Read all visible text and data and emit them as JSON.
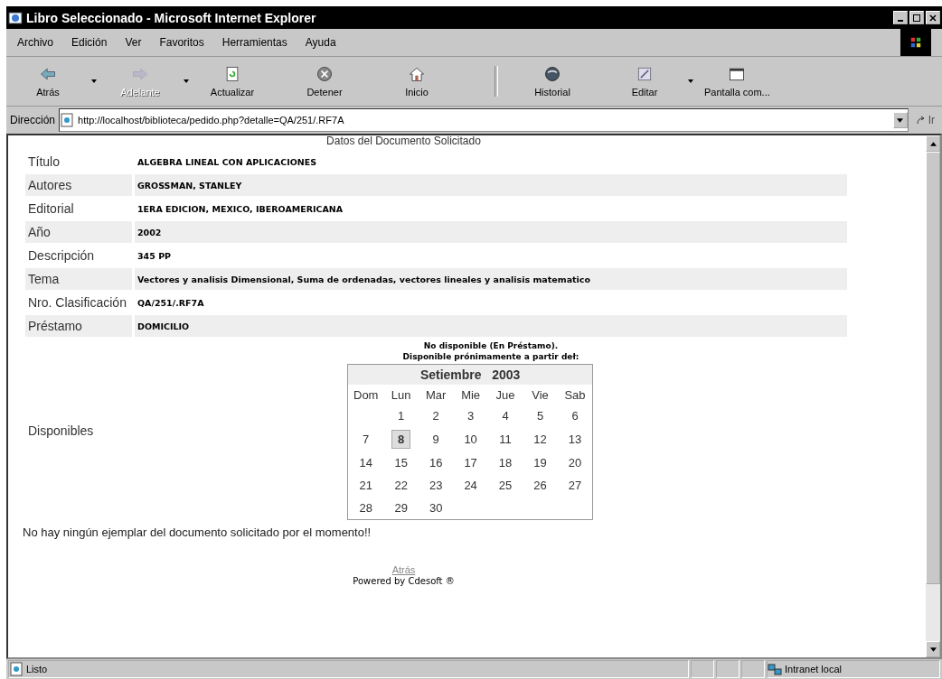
{
  "window": {
    "title": "Libro Seleccionado - Microsoft Internet Explorer"
  },
  "menu": [
    "Archivo",
    "Edición",
    "Ver",
    "Favoritos",
    "Herramientas",
    "Ayuda"
  ],
  "toolbar": [
    {
      "label": "Atrás",
      "kind": "back",
      "disabled": false,
      "dropdown": true
    },
    {
      "label": "Adelante",
      "kind": "forward",
      "disabled": true,
      "dropdown": true
    },
    {
      "label": "Actualizar",
      "kind": "refresh",
      "disabled": false,
      "dropdown": false
    },
    {
      "label": "Detener",
      "kind": "stop",
      "disabled": false,
      "dropdown": false
    },
    {
      "label": "Inicio",
      "kind": "home",
      "disabled": false,
      "dropdown": false
    },
    {
      "label": "Historial",
      "kind": "history",
      "disabled": false,
      "dropdown": false
    },
    {
      "label": "Editar",
      "kind": "edit",
      "disabled": false,
      "dropdown": true
    },
    {
      "label": "Pantalla com...",
      "kind": "fullscreen",
      "disabled": false,
      "dropdown": false
    }
  ],
  "address": {
    "label": "Dirección",
    "value": "http://localhost/biblioteca/pedido.php?detalle=QA/251/.RF7A",
    "go": "Ir"
  },
  "page": {
    "heading": "Datos del Documento Solicitado",
    "fields": [
      {
        "label": "Título",
        "value": "ALGEBRA LINEAL CON APLICACIONES"
      },
      {
        "label": "Autores",
        "value": "GROSSMAN, STANLEY"
      },
      {
        "label": "Editorial",
        "value": "1ERA EDICION, MEXICO, IBEROAMERICANA"
      },
      {
        "label": "Año",
        "value": "2002"
      },
      {
        "label": "Descripción",
        "value": "345 PP"
      },
      {
        "label": "Tema",
        "value": "Vectores y analisis Dimensional, Suma de ordenadas, vectores lineales y analisis matematico"
      },
      {
        "label": "Nro. Clasificación",
        "value": "QA/251/.RF7A"
      },
      {
        "label": "Préstamo",
        "value": "DOMICILIO"
      }
    ],
    "availability": {
      "label": "Disponibles",
      "status": "No disponible (En Préstamo).",
      "note": "Disponible prónimamente a partir deł:",
      "calendar": {
        "month": "Setiembre",
        "year": "2003",
        "weekdays": [
          "Dom",
          "Lun",
          "Mar",
          "Mie",
          "Jue",
          "Vie",
          "Sab"
        ],
        "weeks": [
          {
            "days": [
              {
                "day": "1",
                "selected": false
              },
              {
                "day": "2",
                "selected": false
              },
              {
                "day": "3",
                "selected": false
              },
              {
                "day": "4",
                "selected": false
              },
              {
                "day": "5",
                "selected": false
              },
              {
                "day": "6",
                "selected": false
              }
            ]
          },
          {
            "days": [
              {
                "day": "7",
                "selected": false
              },
              {
                "day": "8",
                "selected": true
              },
              {
                "day": "9",
                "selected": false
              },
              {
                "day": "10",
                "selected": false
              },
              {
                "day": "11",
                "selected": false
              },
              {
                "day": "12",
                "selected": false
              },
              {
                "day": "13",
                "selected": false
              }
            ]
          },
          {
            "days": [
              {
                "day": "14",
                "selected": false
              },
              {
                "day": "15",
                "selected": false
              },
              {
                "day": "16",
                "selected": false
              },
              {
                "day": "17",
                "selected": false
              },
              {
                "day": "18",
                "selected": false
              },
              {
                "day": "19",
                "selected": false
              },
              {
                "day": "20",
                "selected": false
              }
            ]
          },
          {
            "days": [
              {
                "day": "21",
                "selected": false
              },
              {
                "day": "22",
                "selected": false
              },
              {
                "day": "23",
                "selected": false
              },
              {
                "day": "24",
                "selected": false
              },
              {
                "day": "25",
                "selected": false
              },
              {
                "day": "26",
                "selected": false
              },
              {
                "day": "27",
                "selected": false
              }
            ]
          },
          {
            "days": [
              {
                "day": "28",
                "selected": false
              },
              {
                "day": "29",
                "selected": false
              },
              {
                "day": "30",
                "selected": false
              }
            ]
          }
        ]
      }
    },
    "message": "No hay ningún ejemplar del documento solicitado por el momento!!",
    "back_link": "Atrás",
    "powered": "Powered by Cdesoft ®"
  },
  "status_bar": {
    "text": "Listo",
    "zone": "Intranet local"
  }
}
